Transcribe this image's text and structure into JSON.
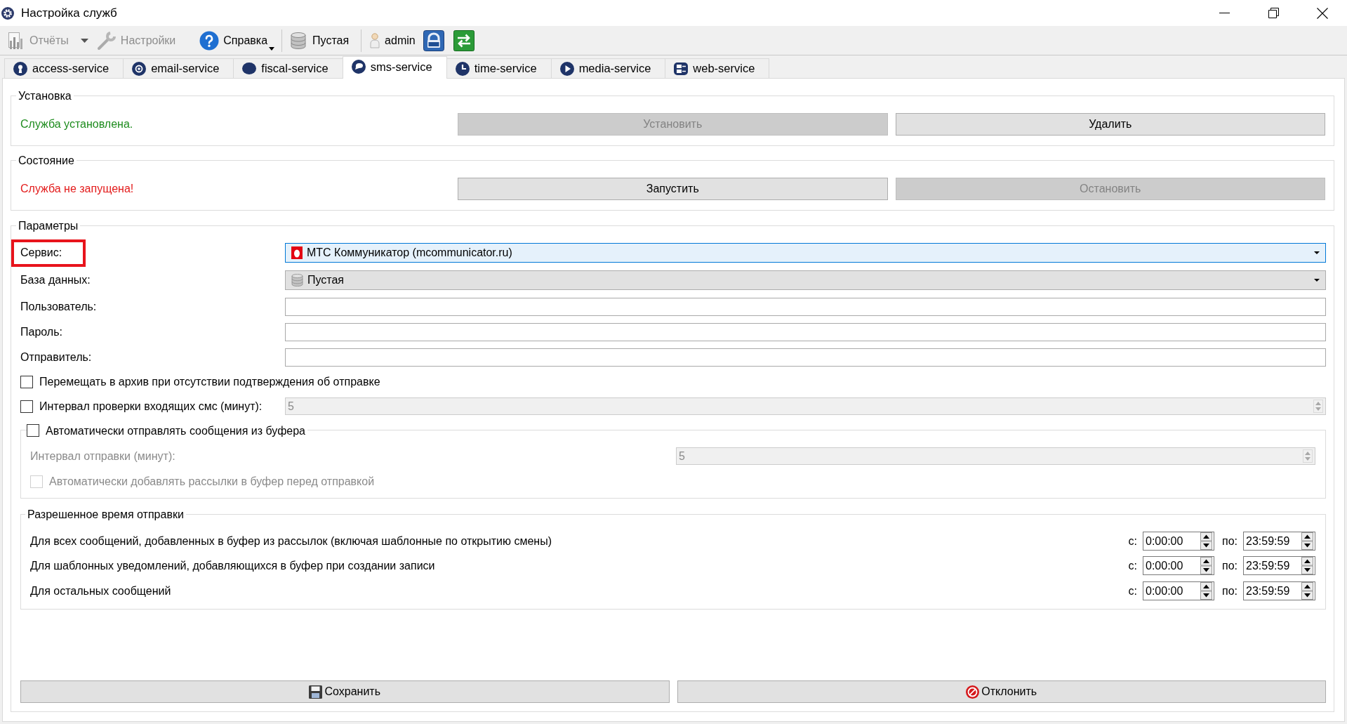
{
  "window": {
    "title": "Настройка служб"
  },
  "toolbar": {
    "reports": {
      "label": "Отчёты",
      "disabled": true
    },
    "settings": {
      "label": "Настройки",
      "disabled": true
    },
    "help": {
      "label": "Справка",
      "disabled": false
    },
    "database": {
      "label": "Пустая"
    },
    "user": {
      "label": "admin"
    }
  },
  "tabs": [
    {
      "label": "access-service",
      "selected": false
    },
    {
      "label": "email-service",
      "selected": false
    },
    {
      "label": "fiscal-service",
      "selected": false
    },
    {
      "label": "sms-service",
      "selected": true
    },
    {
      "label": "time-service",
      "selected": false
    },
    {
      "label": "media-service",
      "selected": false
    },
    {
      "label": "web-service",
      "selected": false
    }
  ],
  "install": {
    "title": "Установка",
    "status": "Служба установлена.",
    "ok": true,
    "buttons": [
      {
        "label": "Установить",
        "disabled": true
      },
      {
        "label": "Удалить",
        "disabled": false
      }
    ]
  },
  "state": {
    "title": "Состояние",
    "status": "Служба не запущена!",
    "ok": false,
    "buttons": [
      {
        "label": "Запустить",
        "disabled": false
      },
      {
        "label": "Остановить",
        "disabled": true
      }
    ]
  },
  "params": {
    "title": "Параметры",
    "service": {
      "label": "Сервис:",
      "value": "МТС Коммуникатор (mcommunicator.ru)",
      "focused": true,
      "marked": true
    },
    "database": {
      "label": "База данных:",
      "value": "Пустая",
      "focused": false
    },
    "text_fields": [
      {
        "label": "Пользователь:"
      },
      {
        "label": "Пароль:"
      },
      {
        "label": "Отправитель:"
      }
    ],
    "archive_option": {
      "label": "Перемещать в архив при отсутствии подтверждения об отправке",
      "checked": false
    },
    "incoming_check": {
      "label": "Интервал проверки входящих смс (минут):",
      "checked": false,
      "value": "5"
    },
    "auto_send": {
      "label": "Автоматически отправлять сообщения из буфера",
      "checked": false,
      "interval_label": "Интервал отправки (минут):",
      "interval_value": "5",
      "add_to_buffer": {
        "label": "Автоматически добавлять рассылки в буфер перед отправкой",
        "checked": false
      }
    },
    "schedule": {
      "title": "Разрешенное время отправки",
      "rows": [
        {
          "label": "Для всех сообщений, добавленных в буфер из рассылок (включая шаблонные по открытию смены)",
          "from_label": "с:",
          "from": "0:00:00",
          "to_label": "по:",
          "to": "23:59:59"
        },
        {
          "label": "Для шаблонных уведомлений, добавляющихся в буфер при создании записи",
          "from_label": "с:",
          "from": "0:00:00",
          "to_label": "по:",
          "to": "23:59:59"
        },
        {
          "label": "Для остальных сообщений",
          "from_label": "с:",
          "from": "0:00:00",
          "to_label": "по:",
          "to": "23:59:59"
        }
      ]
    }
  },
  "footer_buttons": [
    {
      "label": "Сохранить"
    },
    {
      "label": "Отклонить"
    }
  ]
}
